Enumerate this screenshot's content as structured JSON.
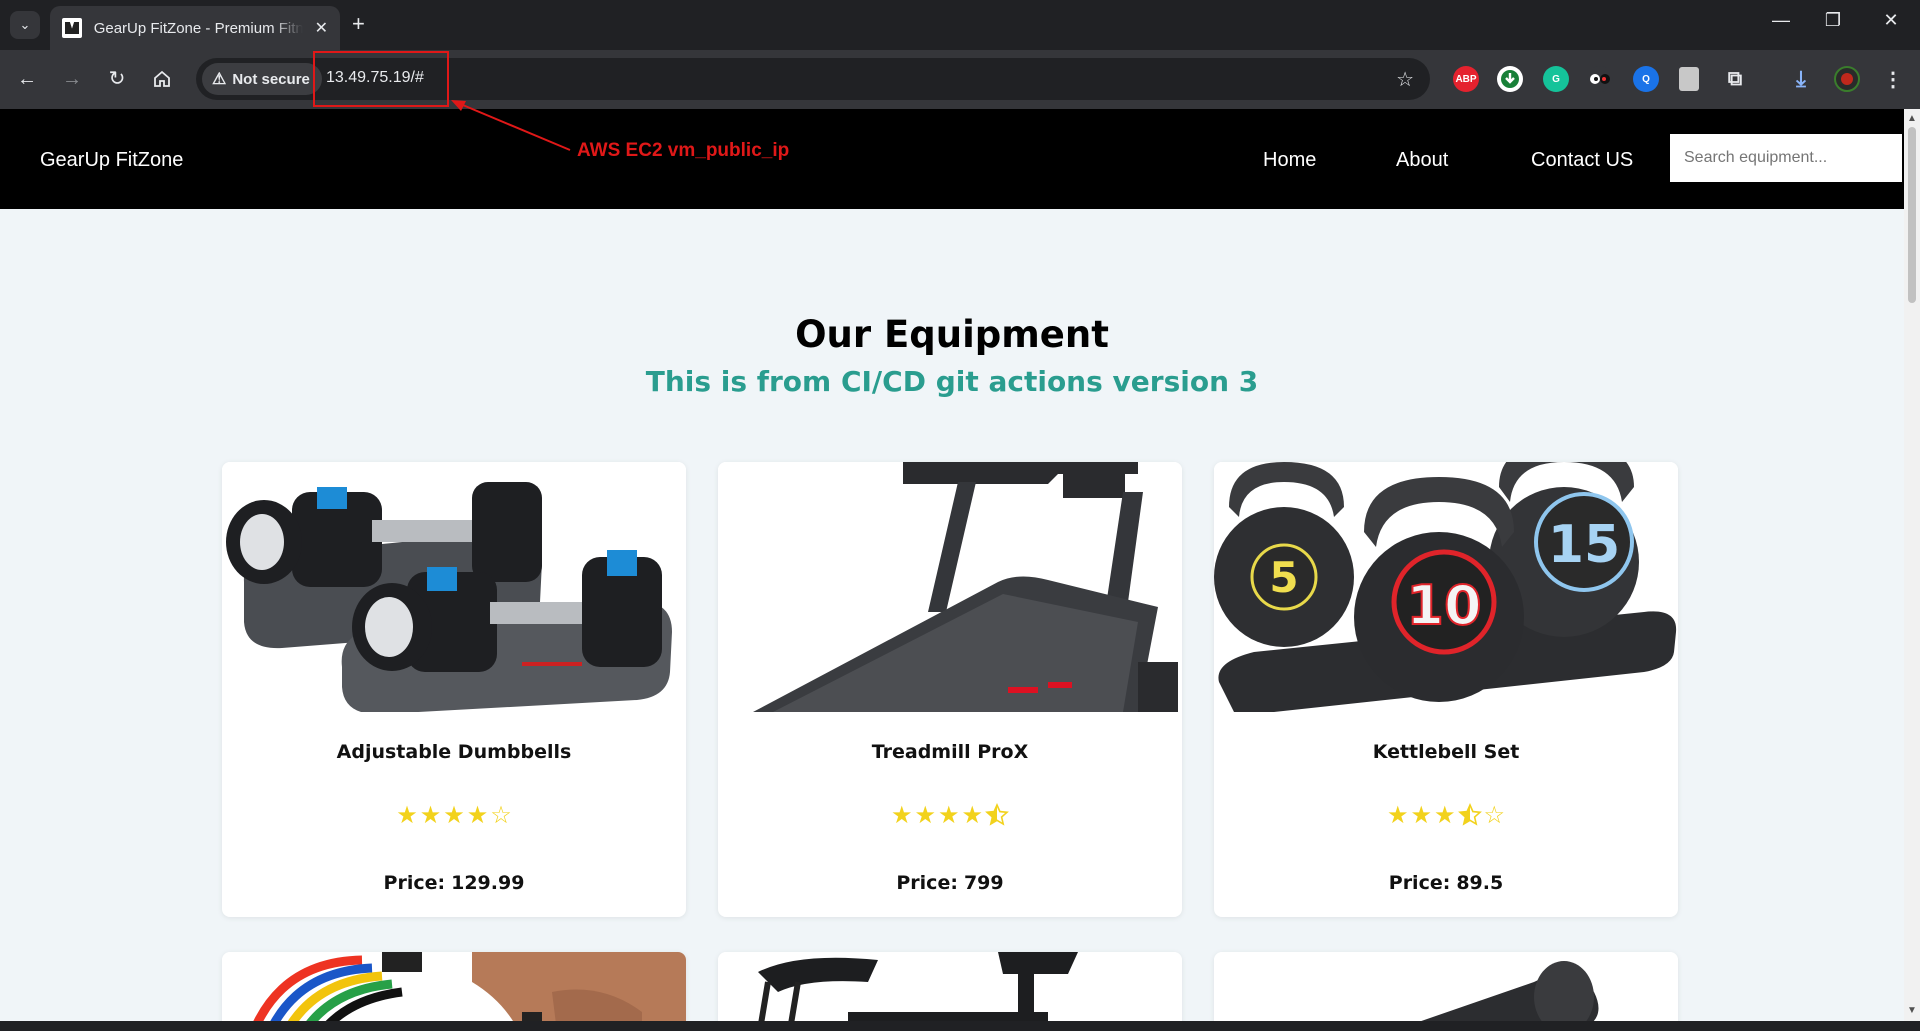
{
  "browser": {
    "tab_title": "GearUp FitZone - Premium Fitness Equipment",
    "security_label": "Not secure",
    "url": "13.49.75.19/#",
    "extensions": [
      "ABP"
    ]
  },
  "annotation": {
    "label": "AWS EC2 vm_public_ip",
    "color": "#e01818"
  },
  "site": {
    "brand": "GearUp FitZone",
    "nav": {
      "home": "Home",
      "about": "About",
      "contact": "Contact US"
    },
    "search_placeholder": "Search equipment...",
    "heading": "Our Equipment",
    "subheading": "This is from CI/CD git actions version 3",
    "price_label": "Price:",
    "accent_color": "#2a9d8f",
    "star_color": "#f2d21c"
  },
  "products": [
    {
      "name": "Adjustable Dumbbells",
      "rating": 4,
      "price": "129.99",
      "image": "dumbbells-image"
    },
    {
      "name": "Treadmill ProX",
      "rating": 4.5,
      "price": "799",
      "image": "treadmill-image"
    },
    {
      "name": "Kettlebell Set",
      "rating": 3.5,
      "price": "89.5",
      "image": "kettlebells-image"
    }
  ],
  "kettlebell_labels": [
    "5",
    "10",
    "15"
  ]
}
